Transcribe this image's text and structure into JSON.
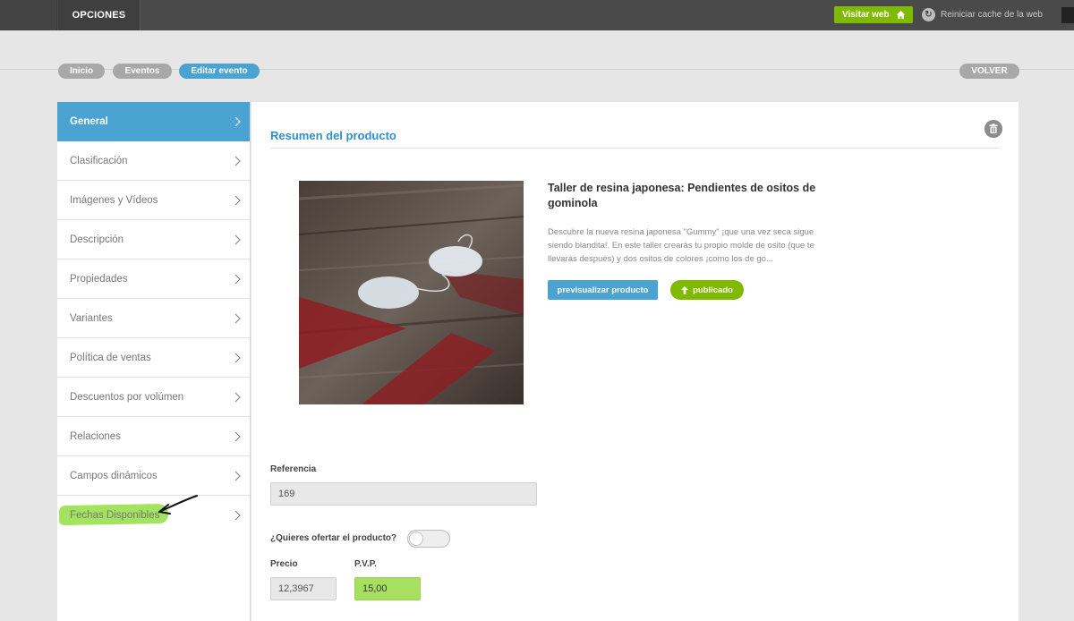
{
  "topbar": {
    "options_label": "OPCIONES",
    "visit_label": "Visitar web",
    "reset_cache_label": "Reiniciar cache de la web"
  },
  "breadcrumbs": [
    "Inicio",
    "Eventos",
    "Editar evento"
  ],
  "back_label": "VOLVER",
  "sidebar": {
    "items": [
      {
        "label": "General",
        "active": true
      },
      {
        "label": "Clasificación"
      },
      {
        "label": "Imágenes y Vídeos"
      },
      {
        "label": "Descripción"
      },
      {
        "label": "Propiedades"
      },
      {
        "label": "Variantes"
      },
      {
        "label": "Política de ventas"
      },
      {
        "label": "Descuentos por volúmen"
      },
      {
        "label": "Relaciones"
      },
      {
        "label": "Campos dinámicos"
      },
      {
        "label": "Fechas Disponibles",
        "highlighted": true
      }
    ]
  },
  "main": {
    "title": "Resumen del producto",
    "product": {
      "title": "Taller de resina japonesa: Pendientes de ositos de gominola",
      "description": "Descubre la nueva resina japonesa \"Gummy\" ¡que una vez seca sigue siendo blandita!. En este taller crearás tu propio molde de osito (que te llevarás después) y dos ositos de colores ¡como los de go...",
      "preview_label": "previsualizar producto",
      "published_label": "publicado"
    },
    "form": {
      "reference_label": "Referencia",
      "reference_value": "169",
      "offer_label": "¿Quieres ofertar el producto?",
      "offer_enabled": false,
      "price_label": "Precio",
      "price_value": "12,3967",
      "pvp_label": "P.V.P.",
      "pvp_value": "15,00"
    }
  },
  "colors": {
    "accent_blue": "#4ba3d1",
    "accent_green": "#7fba00",
    "highlight_green": "#9ae04e",
    "topbar": "#4a4a4a"
  }
}
